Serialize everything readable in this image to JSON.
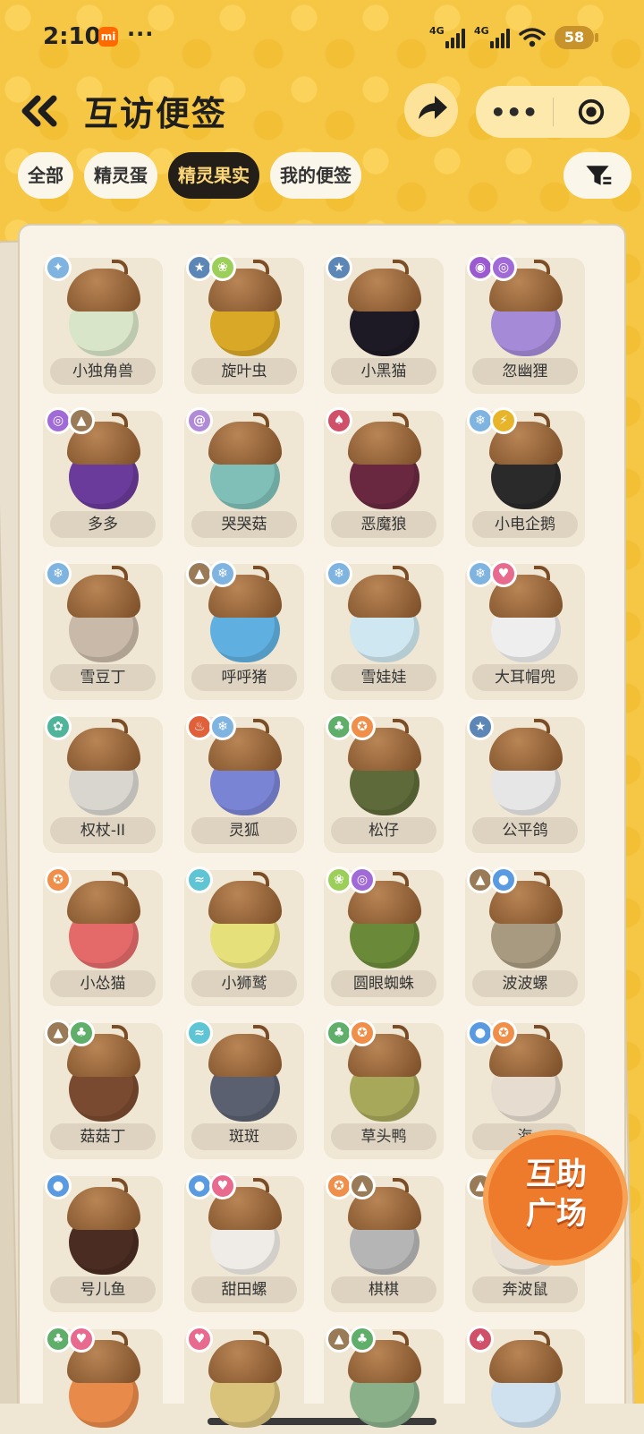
{
  "status_bar": {
    "time": "2:10",
    "carrier_badge": "mi",
    "dots": "···",
    "network1": "4G",
    "network2": "4G",
    "battery": "58"
  },
  "header": {
    "title": "互访便签",
    "back_icon": "double-chevron-left-icon",
    "share_icon": "share-arrow-icon",
    "more_icon": "more-dots-icon",
    "close_icon": "target-close-icon"
  },
  "tabs": [
    {
      "label": "全部",
      "active": false
    },
    {
      "label": "精灵蛋",
      "active": false
    },
    {
      "label": "精灵果实",
      "active": true
    },
    {
      "label": "我的便签",
      "active": false
    }
  ],
  "filter_icon": "filter-icon",
  "colors": {
    "accent": "#f6c745",
    "active_tab_bg": "#231e18",
    "active_tab_text": "#fcd77a",
    "help_badge": "#ee7b2b"
  },
  "items": [
    {
      "name": "小独角兽",
      "color": "#d8e5c8",
      "badges": [
        {
          "type": "ice",
          "color": "#7fb3e0",
          "glyph": "✦"
        }
      ]
    },
    {
      "name": "旋叶虫",
      "color": "#d9a827",
      "badges": [
        {
          "type": "star",
          "color": "#5b86b5",
          "glyph": "★"
        },
        {
          "type": "bug",
          "color": "#9ccf5a",
          "glyph": "❀"
        }
      ]
    },
    {
      "name": "小黑猫",
      "color": "#1e1a25",
      "badges": [
        {
          "type": "star",
          "color": "#5b86b5",
          "glyph": "★"
        }
      ]
    },
    {
      "name": "忽幽狸",
      "color": "#a58ad8",
      "badges": [
        {
          "type": "ghost",
          "color": "#9b5ad0",
          "glyph": "◉"
        },
        {
          "type": "psychic",
          "color": "#a06bd6",
          "glyph": "◎"
        }
      ]
    },
    {
      "name": "多多",
      "color": "#6a3b9a",
      "badges": [
        {
          "type": "psychic",
          "color": "#a06bd6",
          "glyph": "◎"
        },
        {
          "type": "earth",
          "color": "#9a7b58",
          "glyph": "▲"
        }
      ]
    },
    {
      "name": "哭哭菇",
      "color": "#7fbfb8",
      "badges": [
        {
          "type": "swirl",
          "color": "#b18ad8",
          "glyph": "@"
        }
      ]
    },
    {
      "name": "恶魔狼",
      "color": "#6a2840",
      "badges": [
        {
          "type": "demon",
          "color": "#d0506a",
          "glyph": "♠"
        }
      ]
    },
    {
      "name": "小电企鹅",
      "color": "#2a2a2a",
      "badges": [
        {
          "type": "ice",
          "color": "#7fb3e0",
          "glyph": "❄"
        },
        {
          "type": "electric",
          "color": "#e8b52a",
          "glyph": "⚡"
        }
      ]
    },
    {
      "name": "雪豆丁",
      "color": "#c9b9a8",
      "badges": [
        {
          "type": "ice",
          "color": "#7fb3e0",
          "glyph": "❄"
        }
      ]
    },
    {
      "name": "呼呼猪",
      "color": "#5fb0e0",
      "badges": [
        {
          "type": "earth",
          "color": "#9a7b58",
          "glyph": "▲"
        },
        {
          "type": "ice",
          "color": "#7fb3e0",
          "glyph": "❄"
        }
      ]
    },
    {
      "name": "雪娃娃",
      "color": "#cfe7f0",
      "badges": [
        {
          "type": "ice",
          "color": "#7fb3e0",
          "glyph": "❄"
        }
      ]
    },
    {
      "name": "大耳帽兜",
      "color": "#eeeeee",
      "badges": [
        {
          "type": "ice",
          "color": "#7fb3e0",
          "glyph": "❄"
        },
        {
          "type": "heart",
          "color": "#e86a8e",
          "glyph": "♥"
        }
      ]
    },
    {
      "name": "权杖-II",
      "color": "#d9d6d0",
      "badges": [
        {
          "type": "mech",
          "color": "#4fb59a",
          "glyph": "✿"
        }
      ]
    },
    {
      "name": "灵狐",
      "color": "#7a84d4",
      "badges": [
        {
          "type": "fire",
          "color": "#e0603a",
          "glyph": "♨"
        },
        {
          "type": "ice",
          "color": "#7fb3e0",
          "glyph": "❄"
        }
      ]
    },
    {
      "name": "松仔",
      "color": "#5f6a3a",
      "badges": [
        {
          "type": "grass",
          "color": "#5fae6a",
          "glyph": "♣"
        },
        {
          "type": "fighter",
          "color": "#ef8f4a",
          "glyph": "✪"
        }
      ]
    },
    {
      "name": "公平鸽",
      "color": "#e6e6e6",
      "badges": [
        {
          "type": "star",
          "color": "#5b86b5",
          "glyph": "★"
        }
      ]
    },
    {
      "name": "小怂猫",
      "color": "#e46a6a",
      "badges": [
        {
          "type": "fighter",
          "color": "#ef8f4a",
          "glyph": "✪"
        }
      ]
    },
    {
      "name": "小狮鹫",
      "color": "#e6e07a",
      "badges": [
        {
          "type": "wind",
          "color": "#5fc5d5",
          "glyph": "≈"
        }
      ]
    },
    {
      "name": "圆眼蜘蛛",
      "color": "#6a8a3a",
      "badges": [
        {
          "type": "bug",
          "color": "#9ccf5a",
          "glyph": "❀"
        },
        {
          "type": "psychic",
          "color": "#a06bd6",
          "glyph": "◎"
        }
      ]
    },
    {
      "name": "波波螺",
      "color": "#a89a80",
      "badges": [
        {
          "type": "earth",
          "color": "#9a7b58",
          "glyph": "▲"
        },
        {
          "type": "water",
          "color": "#5a9ae0",
          "glyph": "●"
        }
      ]
    },
    {
      "name": "菇菇丁",
      "color": "#7a4a30",
      "badges": [
        {
          "type": "earth",
          "color": "#9a7b58",
          "glyph": "▲"
        },
        {
          "type": "grass",
          "color": "#5fae6a",
          "glyph": "♣"
        }
      ]
    },
    {
      "name": "斑斑",
      "color": "#5a6070",
      "badges": [
        {
          "type": "wind",
          "color": "#5fc5d5",
          "glyph": "≈"
        }
      ]
    },
    {
      "name": "草头鸭",
      "color": "#a8a85a",
      "badges": [
        {
          "type": "grass",
          "color": "#5fae6a",
          "glyph": "♣"
        },
        {
          "type": "fighter",
          "color": "#ef8f4a",
          "glyph": "✪"
        }
      ]
    },
    {
      "name": "海",
      "color": "#e6dcd0",
      "badges": [
        {
          "type": "water",
          "color": "#5a9ae0",
          "glyph": "●"
        },
        {
          "type": "fighter",
          "color": "#ef8f4a",
          "glyph": "✪"
        }
      ]
    },
    {
      "name": "号儿鱼",
      "color": "#4a2c22",
      "badges": [
        {
          "type": "water",
          "color": "#5a9ae0",
          "glyph": "●"
        }
      ]
    },
    {
      "name": "甜田螺",
      "color": "#efebe6",
      "badges": [
        {
          "type": "water",
          "color": "#5a9ae0",
          "glyph": "●"
        },
        {
          "type": "heart",
          "color": "#e86a8e",
          "glyph": "♥"
        }
      ]
    },
    {
      "name": "棋棋",
      "color": "#b5b5b5",
      "badges": [
        {
          "type": "fighter",
          "color": "#ef8f4a",
          "glyph": "✪"
        },
        {
          "type": "earth",
          "color": "#9a7b58",
          "glyph": "▲"
        }
      ]
    },
    {
      "name": "奔波鼠",
      "color": "#e8e0d5",
      "badges": [
        {
          "type": "earth",
          "color": "#9a7b58",
          "glyph": "▲"
        }
      ]
    },
    {
      "name": "",
      "color": "#e88a4a",
      "badges": [
        {
          "type": "grass",
          "color": "#5fae6a",
          "glyph": "♣"
        },
        {
          "type": "heart",
          "color": "#e86a8e",
          "glyph": "♥"
        }
      ]
    },
    {
      "name": "",
      "color": "#d9c27a",
      "badges": [
        {
          "type": "heart",
          "color": "#e86a8e",
          "glyph": "♥"
        }
      ]
    },
    {
      "name": "",
      "color": "#8ab08a",
      "badges": [
        {
          "type": "earth",
          "color": "#9a7b58",
          "glyph": "▲"
        },
        {
          "type": "grass",
          "color": "#5fae6a",
          "glyph": "♣"
        }
      ]
    },
    {
      "name": "",
      "color": "#cfe1ef",
      "badges": [
        {
          "type": "demon",
          "color": "#d0506a",
          "glyph": "♠"
        }
      ]
    }
  ],
  "help_badge": {
    "line1": "互助",
    "line2": "广场"
  }
}
